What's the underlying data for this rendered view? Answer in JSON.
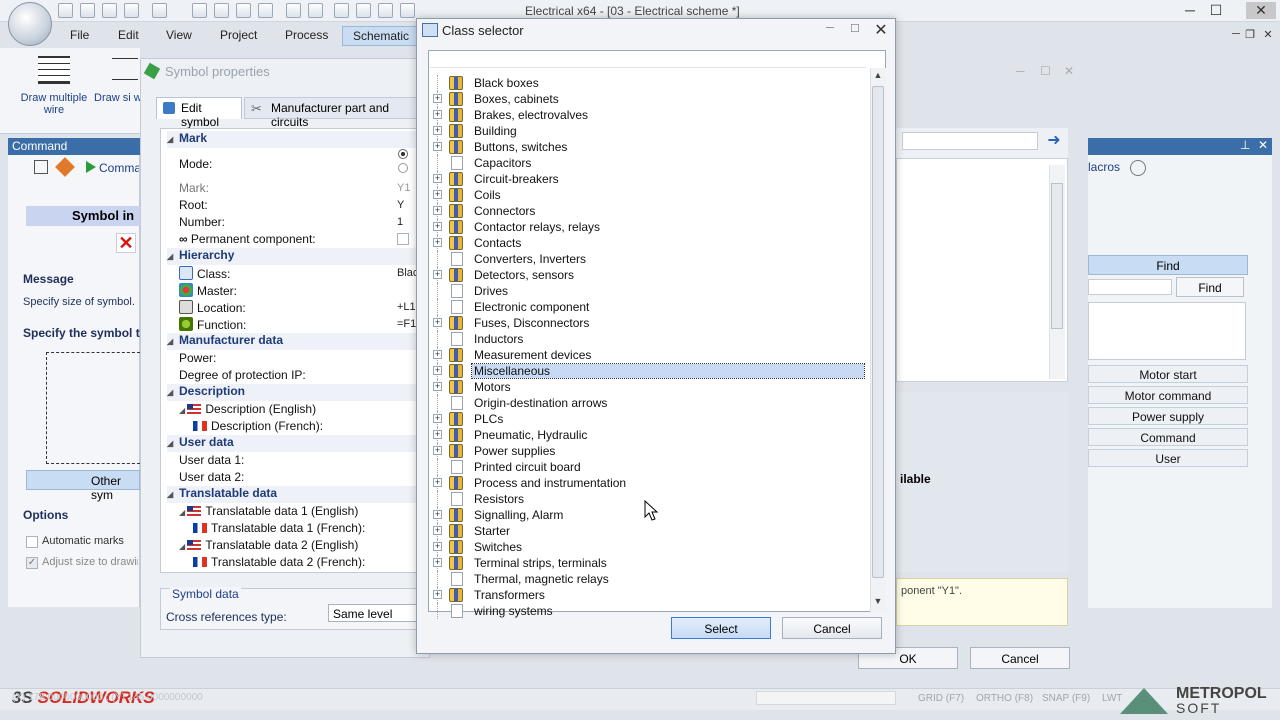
{
  "app": {
    "window_title": "Electrical x64 - [03 - Electrical scheme *]",
    "menus": [
      "File",
      "Edit",
      "View",
      "Project",
      "Process",
      "Schematic"
    ],
    "ribbon": {
      "btn1": "Draw multiple wire",
      "btn2": "Draw si wire"
    }
  },
  "command_panel": {
    "title": "Command",
    "toolbar_label": "Comman",
    "symbol_intro": "Symbol in",
    "message_title": "Message",
    "message_text": "Specify size of symbol.",
    "specify_title": "Specify the symbol t",
    "other_symbols": "Other sym",
    "options_title": "Options",
    "opt_auto_marks": "Automatic marks",
    "opt_adjust": "Adjust size to drawin"
  },
  "symbol_properties": {
    "title": "Symbol properties",
    "tab_edit": "Edit symbol",
    "tab_manufacturer": "Manufacturer part and circuits",
    "sections": {
      "mark": "Mark",
      "hierarchy": "Hierarchy",
      "manufacturer": "Manufacturer data",
      "description": "Description",
      "user_data": "User data",
      "translatable": "Translatable data"
    },
    "rows": {
      "mode": "Mode:",
      "mark": "Mark:",
      "mark_val": "Y1",
      "root": "Root:",
      "root_val": "Y",
      "number": "Number:",
      "number_val": "1",
      "permanent": "Permanent component:",
      "class": "Class:",
      "class_val": "Blac",
      "master": "Master:",
      "location": "Location:",
      "location_val": "+L1",
      "function": "Function:",
      "function_val": "=F1",
      "power": "Power:",
      "ip": "Degree of protection IP:",
      "desc_en": "Description (English)",
      "desc_fr": "Description (French):",
      "user1": "User data 1:",
      "user2": "User data 2:",
      "trans1_en": "Translatable data 1 (English)",
      "trans1_fr": "Translatable data 1 (French):",
      "trans2_en": "Translatable data 2 (English)",
      "trans2_fr": "Translatable data 2 (French):"
    },
    "symbol_data_label": "Symbol data",
    "cross_ref_label": "Cross references type:",
    "cross_ref_value": "Same level",
    "ok": "OK",
    "cancel": "Cancel"
  },
  "right_panel": {
    "macros": "lacros",
    "find_header": "Find",
    "find_btn": "Find",
    "buttons": [
      "Motor start",
      "Motor command",
      "Power supply",
      "Command",
      "User"
    ],
    "available": "ilable",
    "message": "ponent \"Y1\"."
  },
  "class_selector": {
    "title": "Class selector",
    "items": [
      {
        "label": "Black boxes",
        "expandable": false,
        "folder": true
      },
      {
        "label": "Boxes, cabinets",
        "expandable": true,
        "folder": true
      },
      {
        "label": "Brakes, electrovalves",
        "expandable": true,
        "folder": true
      },
      {
        "label": "Building",
        "expandable": true,
        "folder": true
      },
      {
        "label": "Buttons, switches",
        "expandable": true,
        "folder": true
      },
      {
        "label": "Capacitors",
        "expandable": false,
        "folder": false
      },
      {
        "label": "Circuit-breakers",
        "expandable": true,
        "folder": true
      },
      {
        "label": "Coils",
        "expandable": true,
        "folder": true
      },
      {
        "label": "Connectors",
        "expandable": true,
        "folder": true
      },
      {
        "label": "Contactor relays, relays",
        "expandable": true,
        "folder": true
      },
      {
        "label": "Contacts",
        "expandable": true,
        "folder": true
      },
      {
        "label": "Converters, Inverters",
        "expandable": false,
        "folder": false
      },
      {
        "label": "Detectors, sensors",
        "expandable": true,
        "folder": true
      },
      {
        "label": "Drives",
        "expandable": false,
        "folder": false
      },
      {
        "label": "Electronic component",
        "expandable": false,
        "folder": false
      },
      {
        "label": "Fuses, Disconnectors",
        "expandable": true,
        "folder": true
      },
      {
        "label": "Inductors",
        "expandable": false,
        "folder": false
      },
      {
        "label": "Measurement devices",
        "expandable": true,
        "folder": true
      },
      {
        "label": "Miscellaneous",
        "expandable": true,
        "folder": true,
        "selected": true
      },
      {
        "label": "Motors",
        "expandable": true,
        "folder": true
      },
      {
        "label": "Origin-destination arrows",
        "expandable": false,
        "folder": false
      },
      {
        "label": "PLCs",
        "expandable": true,
        "folder": true
      },
      {
        "label": "Pneumatic, Hydraulic",
        "expandable": true,
        "folder": true
      },
      {
        "label": "Power supplies",
        "expandable": true,
        "folder": true
      },
      {
        "label": "Printed circuit board",
        "expandable": false,
        "folder": false
      },
      {
        "label": "Process and instrumentation",
        "expandable": true,
        "folder": true
      },
      {
        "label": "Resistors",
        "expandable": false,
        "folder": false
      },
      {
        "label": "Signalling, Alarm",
        "expandable": true,
        "folder": true
      },
      {
        "label": "Starter",
        "expandable": true,
        "folder": true
      },
      {
        "label": "Switches",
        "expandable": true,
        "folder": true
      },
      {
        "label": "Terminal strips, terminals",
        "expandable": true,
        "folder": true
      },
      {
        "label": "Thermal, magnetic relays",
        "expandable": false,
        "folder": false
      },
      {
        "label": "Transformers",
        "expandable": true,
        "folder": true
      },
      {
        "label": "wiring systems",
        "expandable": false,
        "folder": false
      }
    ],
    "select_label": "Select",
    "cancel_label": "Cancel"
  },
  "status": {
    "brand": "SOLIDWORKS",
    "brand_prefix": "3S",
    "coords": "(X) 178.0000000000 ; (Y) 145.0000000000",
    "grid": "GRID (F7)",
    "ortho": "ORTHO (F8)",
    "snap": "SNAP (F9)",
    "lwt": "LWT",
    "vendor_line1": "METROPOL",
    "vendor_line2": "SOFT"
  }
}
